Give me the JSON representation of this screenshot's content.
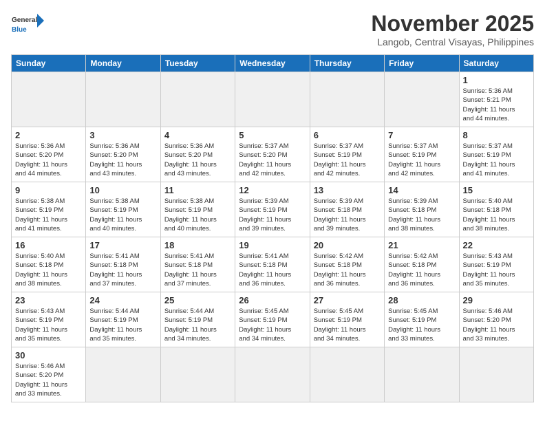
{
  "header": {
    "logo_general": "General",
    "logo_blue": "Blue",
    "month": "November 2025",
    "location": "Langob, Central Visayas, Philippines"
  },
  "weekdays": [
    "Sunday",
    "Monday",
    "Tuesday",
    "Wednesday",
    "Thursday",
    "Friday",
    "Saturday"
  ],
  "weeks": [
    [
      {
        "day": "",
        "info": ""
      },
      {
        "day": "",
        "info": ""
      },
      {
        "day": "",
        "info": ""
      },
      {
        "day": "",
        "info": ""
      },
      {
        "day": "",
        "info": ""
      },
      {
        "day": "",
        "info": ""
      },
      {
        "day": "1",
        "info": "Sunrise: 5:36 AM\nSunset: 5:21 PM\nDaylight: 11 hours\nand 44 minutes."
      }
    ],
    [
      {
        "day": "2",
        "info": "Sunrise: 5:36 AM\nSunset: 5:20 PM\nDaylight: 11 hours\nand 44 minutes."
      },
      {
        "day": "3",
        "info": "Sunrise: 5:36 AM\nSunset: 5:20 PM\nDaylight: 11 hours\nand 43 minutes."
      },
      {
        "day": "4",
        "info": "Sunrise: 5:36 AM\nSunset: 5:20 PM\nDaylight: 11 hours\nand 43 minutes."
      },
      {
        "day": "5",
        "info": "Sunrise: 5:37 AM\nSunset: 5:20 PM\nDaylight: 11 hours\nand 42 minutes."
      },
      {
        "day": "6",
        "info": "Sunrise: 5:37 AM\nSunset: 5:19 PM\nDaylight: 11 hours\nand 42 minutes."
      },
      {
        "day": "7",
        "info": "Sunrise: 5:37 AM\nSunset: 5:19 PM\nDaylight: 11 hours\nand 42 minutes."
      },
      {
        "day": "8",
        "info": "Sunrise: 5:37 AM\nSunset: 5:19 PM\nDaylight: 11 hours\nand 41 minutes."
      }
    ],
    [
      {
        "day": "9",
        "info": "Sunrise: 5:38 AM\nSunset: 5:19 PM\nDaylight: 11 hours\nand 41 minutes."
      },
      {
        "day": "10",
        "info": "Sunrise: 5:38 AM\nSunset: 5:19 PM\nDaylight: 11 hours\nand 40 minutes."
      },
      {
        "day": "11",
        "info": "Sunrise: 5:38 AM\nSunset: 5:19 PM\nDaylight: 11 hours\nand 40 minutes."
      },
      {
        "day": "12",
        "info": "Sunrise: 5:39 AM\nSunset: 5:19 PM\nDaylight: 11 hours\nand 39 minutes."
      },
      {
        "day": "13",
        "info": "Sunrise: 5:39 AM\nSunset: 5:18 PM\nDaylight: 11 hours\nand 39 minutes."
      },
      {
        "day": "14",
        "info": "Sunrise: 5:39 AM\nSunset: 5:18 PM\nDaylight: 11 hours\nand 38 minutes."
      },
      {
        "day": "15",
        "info": "Sunrise: 5:40 AM\nSunset: 5:18 PM\nDaylight: 11 hours\nand 38 minutes."
      }
    ],
    [
      {
        "day": "16",
        "info": "Sunrise: 5:40 AM\nSunset: 5:18 PM\nDaylight: 11 hours\nand 38 minutes."
      },
      {
        "day": "17",
        "info": "Sunrise: 5:41 AM\nSunset: 5:18 PM\nDaylight: 11 hours\nand 37 minutes."
      },
      {
        "day": "18",
        "info": "Sunrise: 5:41 AM\nSunset: 5:18 PM\nDaylight: 11 hours\nand 37 minutes."
      },
      {
        "day": "19",
        "info": "Sunrise: 5:41 AM\nSunset: 5:18 PM\nDaylight: 11 hours\nand 36 minutes."
      },
      {
        "day": "20",
        "info": "Sunrise: 5:42 AM\nSunset: 5:18 PM\nDaylight: 11 hours\nand 36 minutes."
      },
      {
        "day": "21",
        "info": "Sunrise: 5:42 AM\nSunset: 5:18 PM\nDaylight: 11 hours\nand 36 minutes."
      },
      {
        "day": "22",
        "info": "Sunrise: 5:43 AM\nSunset: 5:19 PM\nDaylight: 11 hours\nand 35 minutes."
      }
    ],
    [
      {
        "day": "23",
        "info": "Sunrise: 5:43 AM\nSunset: 5:19 PM\nDaylight: 11 hours\nand 35 minutes."
      },
      {
        "day": "24",
        "info": "Sunrise: 5:44 AM\nSunset: 5:19 PM\nDaylight: 11 hours\nand 35 minutes."
      },
      {
        "day": "25",
        "info": "Sunrise: 5:44 AM\nSunset: 5:19 PM\nDaylight: 11 hours\nand 34 minutes."
      },
      {
        "day": "26",
        "info": "Sunrise: 5:45 AM\nSunset: 5:19 PM\nDaylight: 11 hours\nand 34 minutes."
      },
      {
        "day": "27",
        "info": "Sunrise: 5:45 AM\nSunset: 5:19 PM\nDaylight: 11 hours\nand 34 minutes."
      },
      {
        "day": "28",
        "info": "Sunrise: 5:45 AM\nSunset: 5:19 PM\nDaylight: 11 hours\nand 33 minutes."
      },
      {
        "day": "29",
        "info": "Sunrise: 5:46 AM\nSunset: 5:20 PM\nDaylight: 11 hours\nand 33 minutes."
      }
    ],
    [
      {
        "day": "30",
        "info": "Sunrise: 5:46 AM\nSunset: 5:20 PM\nDaylight: 11 hours\nand 33 minutes."
      },
      {
        "day": "",
        "info": ""
      },
      {
        "day": "",
        "info": ""
      },
      {
        "day": "",
        "info": ""
      },
      {
        "day": "",
        "info": ""
      },
      {
        "day": "",
        "info": ""
      },
      {
        "day": "",
        "info": ""
      }
    ]
  ]
}
